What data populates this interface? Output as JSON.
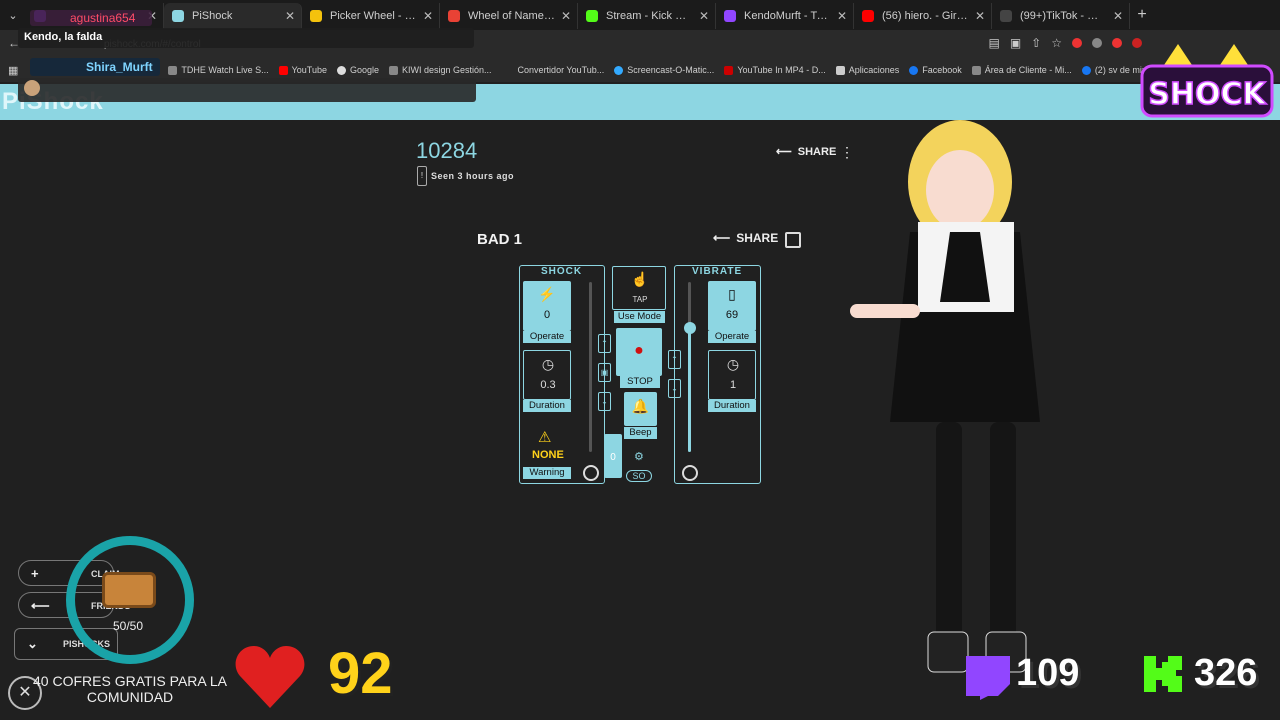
{
  "browser": {
    "tabs": [
      {
        "label": "",
        "color": "#9146ff"
      },
      {
        "label": "PiShock",
        "color": "#8dd6e2"
      },
      {
        "label": "Picker Wheel - Spin the W",
        "color": "#f4c20d"
      },
      {
        "label": "Wheel of Names | Random",
        "color": "#e94235"
      },
      {
        "label": "Stream - Kick Dashboard",
        "color": "#53fc18"
      },
      {
        "label": "KendoMurft - Twitch",
        "color": "#9146ff"
      },
      {
        "label": "(56) hiero. - Girl's Last Gr",
        "color": "#ff0000"
      },
      {
        "label": "(99+)TikTok - Make Your",
        "color": "#444444"
      }
    ],
    "new_tab": "+",
    "url": "pishock.com/#/control",
    "bookmarks": [
      "TDHE Watch Live S...",
      "YouTube",
      "Google",
      "KIWI design Gestión...",
      "Convertidor YouTub...",
      "Screencast-O-Matic...",
      "YouTube In MP4 - D...",
      "Aplicaciones",
      "Facebook",
      "Área de Cliente - Mi...",
      "(2) sv de minecraft..."
    ]
  },
  "chat": {
    "user1": "agustina654",
    "message1": "Kendo, la falda",
    "user2": "Shira_Murft"
  },
  "site": {
    "logo": "PiShock",
    "device_id": "10284",
    "seen_badge": "!",
    "seen_text": "Seen 3 hours ago",
    "share_label": "SHARE",
    "shocker_name": "BAD 1",
    "shock": {
      "title": "SHOCK",
      "intensity": "0",
      "operate_label": "Operate",
      "duration": "0.3",
      "duration_label": "Duration",
      "warning_value": "NONE",
      "warning_label": "Warning"
    },
    "middle": {
      "tap_label": "TAP",
      "use_mode_label": "Use Mode",
      "stop_label": "STOP",
      "beep_label": "Beep",
      "so_label": "SO",
      "zero": "0"
    },
    "vibrate": {
      "title": "VIBRATE",
      "intensity": "69",
      "operate_label": "Operate",
      "duration": "1",
      "duration_label": "Duration",
      "slider_level": 0.73
    }
  },
  "overlay": {
    "claim_label": "CLAIM",
    "friends_label": "FRIENDS",
    "pishock_label": "PISHOCKS",
    "chest_count": "50/50",
    "cofres_text": "40 COFRES GRATIS PARA LA COMUNIDAD",
    "heart_count": "92",
    "twitch_count": "109",
    "kick_count": "326",
    "brand_logo": "SHOCK"
  },
  "colors": {
    "accent": "#8dd6e2",
    "heart": "#e02020",
    "heart_number": "#ffd21a",
    "twitch": "#9146ff",
    "kick": "#53fc18"
  }
}
